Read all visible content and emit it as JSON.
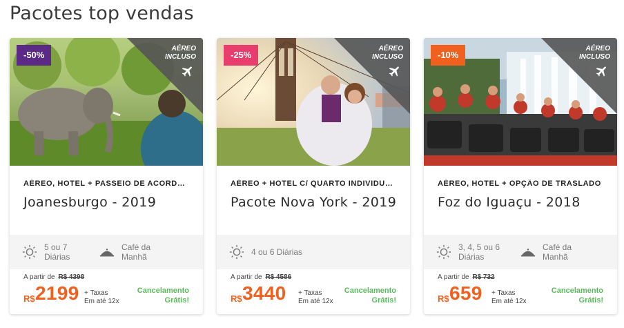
{
  "section": {
    "title": "Pacotes top vendas"
  },
  "colors": {
    "price": "#f0611f",
    "cancel": "#5cb85c",
    "corner": "#555555"
  },
  "cards": [
    {
      "discount": "-50%",
      "discount_color": "#5b2a86",
      "flight_badge": "AÉREO INCLUSO",
      "flight_icon": "airplane-icon",
      "subtitle": "AÉREO, HOTEL + PASSEIO DE ACORDO ...",
      "name": "Joanesburgo - 2019",
      "features": [
        {
          "icon": "sun-icon",
          "label": "5 ou 7 Diárias"
        },
        {
          "icon": "food-cloche-icon",
          "label": "Café da Manhã"
        }
      ],
      "price_prefix": "A partir de",
      "old_price": "R$ 4398",
      "currency": "R$",
      "price": "2199",
      "taxes_line1": "+ Taxas",
      "taxes_line2": "Em até 12x",
      "cancel_line1": "Cancelamento",
      "cancel_line2": "Grátis!"
    },
    {
      "discount": "-25%",
      "discount_color": "#e83e6e",
      "flight_badge": "AÉREO INCLUSO",
      "flight_icon": "airplane-icon",
      "subtitle": "AÉREO + HOTEL C/ QUARTO INDIVIDUA...",
      "name": "Pacote Nova York - 2019",
      "features": [
        {
          "icon": "sun-icon",
          "label": "4 ou 6 Diárias"
        }
      ],
      "price_prefix": "A partir de",
      "old_price": "R$ 4586",
      "currency": "R$",
      "price": "3440",
      "taxes_line1": "+ Taxas",
      "taxes_line2": "Em até 12x",
      "cancel_line1": "Cancelamento",
      "cancel_line2": "Grátis!"
    },
    {
      "discount": "-10%",
      "discount_color": "#f0611f",
      "flight_badge": "AÉREO INCLUSO",
      "flight_icon": "airplane-icon",
      "subtitle": "AÉREO, HOTEL + OPÇÃO DE TRASLADO",
      "name": "Foz do Iguaçu - 2018",
      "features": [
        {
          "icon": "sun-icon",
          "label": "3, 4, 5 ou 6 Diárias"
        },
        {
          "icon": "food-cloche-icon",
          "label": "Café da Manhã"
        }
      ],
      "price_prefix": "A partir de",
      "old_price": "R$ 732",
      "currency": "R$",
      "price": "659",
      "taxes_line1": "+ Taxas",
      "taxes_line2": "Em até 12x",
      "cancel_line1": "Cancelamento",
      "cancel_line2": "Grátis!"
    }
  ]
}
